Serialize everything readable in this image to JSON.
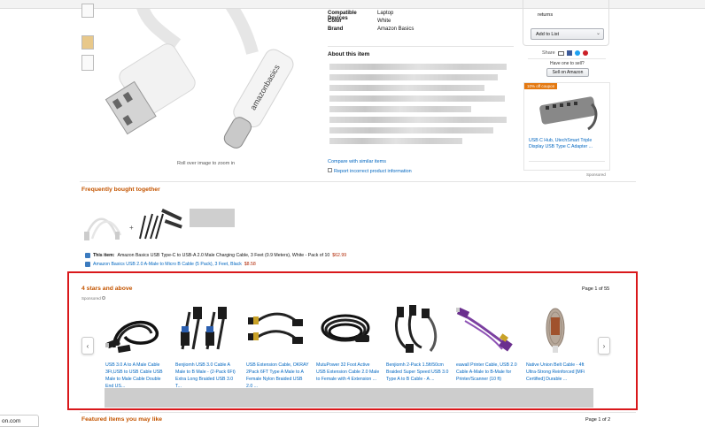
{
  "details": {
    "rows": [
      {
        "label": "Compatible Devices",
        "value": "Laptop"
      },
      {
        "label": "Color",
        "value": "White"
      },
      {
        "label": "Brand",
        "value": "Amazon Basics"
      }
    ],
    "about_title": "About this item",
    "compare_link": "Compare with similar items",
    "report_link": "Report incorrect product information"
  },
  "image": {
    "rollover_hint": "Roll over image to zoom in",
    "logo_text": "amazonbasics"
  },
  "buybox": {
    "returns": "returns",
    "add_to_list": "Add to List",
    "share_label": "Share",
    "sell_question": "Have one to sell?",
    "sell_button": "Sell on Amazon"
  },
  "sponsored_ad": {
    "badge": "10% off coupon",
    "title": "USB C Hub, UtechSmart Triple Display USB Type C Adapter ...",
    "sponsored": "Sponsored"
  },
  "fbt": {
    "title": "Frequently bought together",
    "item1_label": "This item:",
    "item1_text": "Amazon Basics USB Type-C to USB-A 2.0 Male Charging Cable, 3 Feet (0.9 Meters), White - Pack of 10",
    "item1_price": "$62.99",
    "item2_text": "Amazon Basics USB 2.0 A-Male to Micro B Cable (5 Pack), 3 Feet, Black",
    "item2_price": "$8.58"
  },
  "carousel": {
    "title": "4 stars and above",
    "sponsored": "Sponsored",
    "page_label": "Page 1 of 55",
    "prev": "‹",
    "next": "›",
    "items": [
      {
        "caption": "USB 3.0 A to A Male Cable 3Ft,USB to USB Cable USB Male to Male Cable Double End US..."
      },
      {
        "caption": "Benjiomh USB 3.0 Cable A Male to B Male - (2-Pack 6Ft) Extra Long Braided USB 3.0 T..."
      },
      {
        "caption": "USB Extension Cable, OKRAY 2Pack 6FT Type A Male to A Female Nylon Braided USB 2.0 ..."
      },
      {
        "caption": "MutuPower 32 Foot Active USB Extension Cable 2.0 Male to Female with 4 Extension ..."
      },
      {
        "caption": "Benjiomh 2-Pack 1.5ft/50cm Braided Super Speed USB 3.0 Type A to B Cable - A ..."
      },
      {
        "caption": "eawall Printer Cable, USB 2.0 Cable A-Male to B-Male for Printer/Scanner (10 ft)"
      },
      {
        "caption": "Native Union Belt Cable - 4ft Ultra-Strong Reinforced [MFi Certified] Durable ..."
      }
    ]
  },
  "featured": {
    "title": "Featured items you may like",
    "page_label": "Page 1 of 2"
  },
  "status_url": "on.com"
}
